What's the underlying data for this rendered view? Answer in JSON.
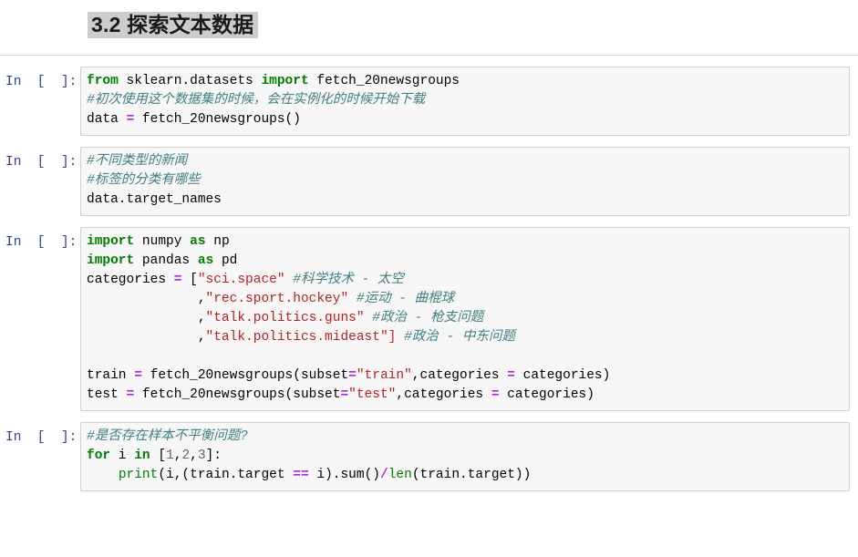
{
  "heading": {
    "text": "3.2 探索文本数据",
    "highlight_color": "#cdcdcd"
  },
  "prompt_label": "In  [  ]:",
  "theme": {
    "cell_background": "#f7f7f7",
    "cell_border": "#cfcfcf",
    "prompt_color": "#303F9F",
    "keyword_color": "#008000",
    "comment_color": "#408080",
    "string_color": "#BA2121",
    "operator_color": "#AA22FF",
    "number_color": "#666666",
    "page_background": "#ffffff"
  },
  "cells": [
    {
      "type": "code",
      "prompt": "In  [  ]:",
      "lines": [
        [
          {
            "t": "from",
            "c": "kn"
          },
          {
            "t": " sklearn.datasets ",
            "c": "n"
          },
          {
            "t": "import",
            "c": "kn"
          },
          {
            "t": " fetch_20newsgroups",
            "c": "n"
          }
        ],
        [
          {
            "t": "#初次使用这个数据集的时候，会在实例化的时候开始下载",
            "c": "c1"
          }
        ],
        [
          {
            "t": "data ",
            "c": "n"
          },
          {
            "t": "=",
            "c": "o"
          },
          {
            "t": " fetch_20newsgroups",
            "c": "n"
          },
          {
            "t": "()",
            "c": "p"
          }
        ]
      ]
    },
    {
      "type": "code",
      "prompt": "In  [  ]:",
      "lines": [
        [
          {
            "t": "#不同类型的新闻",
            "c": "c1"
          }
        ],
        [
          {
            "t": "#标签的分类有哪些",
            "c": "c1"
          }
        ],
        [
          {
            "t": "data.target_names",
            "c": "n"
          }
        ]
      ]
    },
    {
      "type": "code",
      "prompt": "In  [  ]:",
      "lines": [
        [
          {
            "t": "import",
            "c": "kn"
          },
          {
            "t": " numpy ",
            "c": "n"
          },
          {
            "t": "as",
            "c": "k"
          },
          {
            "t": " np",
            "c": "n"
          }
        ],
        [
          {
            "t": "import",
            "c": "kn"
          },
          {
            "t": " pandas ",
            "c": "n"
          },
          {
            "t": "as",
            "c": "k"
          },
          {
            "t": " pd",
            "c": "n"
          }
        ],
        [
          {
            "t": "categories ",
            "c": "n"
          },
          {
            "t": "=",
            "c": "o"
          },
          {
            "t": " [",
            "c": "p"
          },
          {
            "t": "\"sci.space\"",
            "c": "s"
          },
          {
            "t": " ",
            "c": "n"
          },
          {
            "t": "#科学技术 - 太空",
            "c": "c1"
          }
        ],
        [
          {
            "t": "              ,",
            "c": "p"
          },
          {
            "t": "\"rec.sport.hockey\"",
            "c": "s"
          },
          {
            "t": " ",
            "c": "n"
          },
          {
            "t": "#运动 - 曲棍球",
            "c": "c1"
          }
        ],
        [
          {
            "t": "              ,",
            "c": "p"
          },
          {
            "t": "\"talk.politics.guns\"",
            "c": "s"
          },
          {
            "t": " ",
            "c": "n"
          },
          {
            "t": "#政治 - 枪支问题",
            "c": "c1"
          }
        ],
        [
          {
            "t": "              ,",
            "c": "p"
          },
          {
            "t": "\"talk.politics.mideast\"]",
            "c": "s"
          },
          {
            "t": " ",
            "c": "n"
          },
          {
            "t": "#政治 - 中东问题",
            "c": "c1"
          }
        ],
        [
          {
            "t": "",
            "c": "n"
          }
        ],
        [
          {
            "t": "train ",
            "c": "n"
          },
          {
            "t": "=",
            "c": "o"
          },
          {
            "t": " fetch_20newsgroups",
            "c": "n"
          },
          {
            "t": "(",
            "c": "p"
          },
          {
            "t": "subset",
            "c": "n"
          },
          {
            "t": "=",
            "c": "o"
          },
          {
            "t": "\"train\"",
            "c": "s"
          },
          {
            "t": ",",
            "c": "p"
          },
          {
            "t": "categories ",
            "c": "n"
          },
          {
            "t": "=",
            "c": "o"
          },
          {
            "t": " categories",
            "c": "n"
          },
          {
            "t": ")",
            "c": "p"
          }
        ],
        [
          {
            "t": "test ",
            "c": "n"
          },
          {
            "t": "=",
            "c": "o"
          },
          {
            "t": " fetch_20newsgroups",
            "c": "n"
          },
          {
            "t": "(",
            "c": "p"
          },
          {
            "t": "subset",
            "c": "n"
          },
          {
            "t": "=",
            "c": "o"
          },
          {
            "t": "\"test\"",
            "c": "s"
          },
          {
            "t": ",",
            "c": "p"
          },
          {
            "t": "categories ",
            "c": "n"
          },
          {
            "t": "=",
            "c": "o"
          },
          {
            "t": " categories",
            "c": "n"
          },
          {
            "t": ")",
            "c": "p"
          }
        ],
        [
          {
            "t": "",
            "c": "n"
          }
        ]
      ]
    },
    {
      "type": "code",
      "prompt": "In  [  ]:",
      "lines": [
        [
          {
            "t": "#是否存在样本不平衡问题?",
            "c": "c1"
          }
        ],
        [
          {
            "t": "for",
            "c": "k"
          },
          {
            "t": " i ",
            "c": "n"
          },
          {
            "t": "in",
            "c": "k"
          },
          {
            "t": " [",
            "c": "p"
          },
          {
            "t": "1",
            "c": "mi"
          },
          {
            "t": ",",
            "c": "p"
          },
          {
            "t": "2",
            "c": "mi"
          },
          {
            "t": ",",
            "c": "p"
          },
          {
            "t": "3",
            "c": "mi"
          },
          {
            "t": "]:",
            "c": "p"
          }
        ],
        [
          {
            "t": "    ",
            "c": "n"
          },
          {
            "t": "print",
            "c": "nb"
          },
          {
            "t": "(i,(train.target ",
            "c": "p"
          },
          {
            "t": "==",
            "c": "o"
          },
          {
            "t": " i).sum()",
            "c": "p"
          },
          {
            "t": "/",
            "c": "o"
          },
          {
            "t": "len",
            "c": "nb"
          },
          {
            "t": "(train.target))",
            "c": "p"
          }
        ]
      ]
    }
  ]
}
